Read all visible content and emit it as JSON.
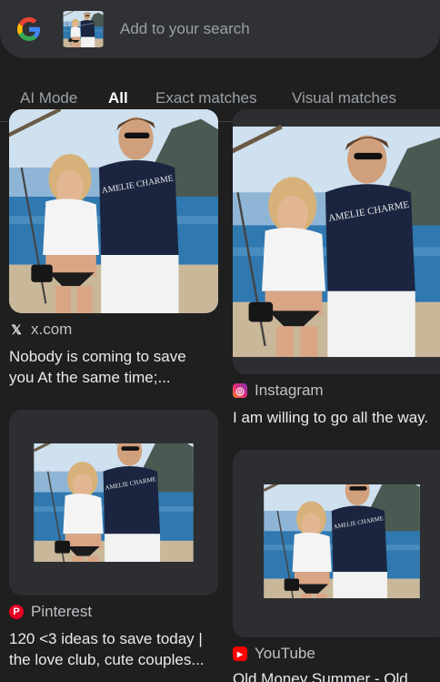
{
  "search": {
    "placeholder": "Add to your search"
  },
  "tabs": [
    {
      "label": "AI Mode",
      "active": false
    },
    {
      "label": "All",
      "active": true
    },
    {
      "label": "Exact matches",
      "active": false
    },
    {
      "label": "Visual matches",
      "active": false
    }
  ],
  "results": [
    {
      "source": "x.com",
      "icon": "x-logo-icon",
      "title_line1": "Nobody is coming to save",
      "title_line2": "you At the same time;..."
    },
    {
      "source": "Instagram",
      "icon": "instagram-icon",
      "title_line1": "I am willing to go all the way.",
      "title_line2": ""
    },
    {
      "source": "Pinterest",
      "icon": "pinterest-icon",
      "title_line1": "120 <3 ideas to save today |",
      "title_line2": "the love club, cute couples..."
    },
    {
      "source": "YouTube",
      "icon": "youtube-icon",
      "title_line1": "Old Money Summer - Old",
      "title_line2": ""
    }
  ],
  "shirt_text": "AMELIE CHARME",
  "colors": {
    "background": "#1f1f1f",
    "search_bar": "#303134",
    "tab_inactive": "#9aa0a6",
    "tab_active": "#ffffff",
    "instagram": "#e1306c",
    "pinterest": "#e60023",
    "youtube": "#ff0000"
  }
}
